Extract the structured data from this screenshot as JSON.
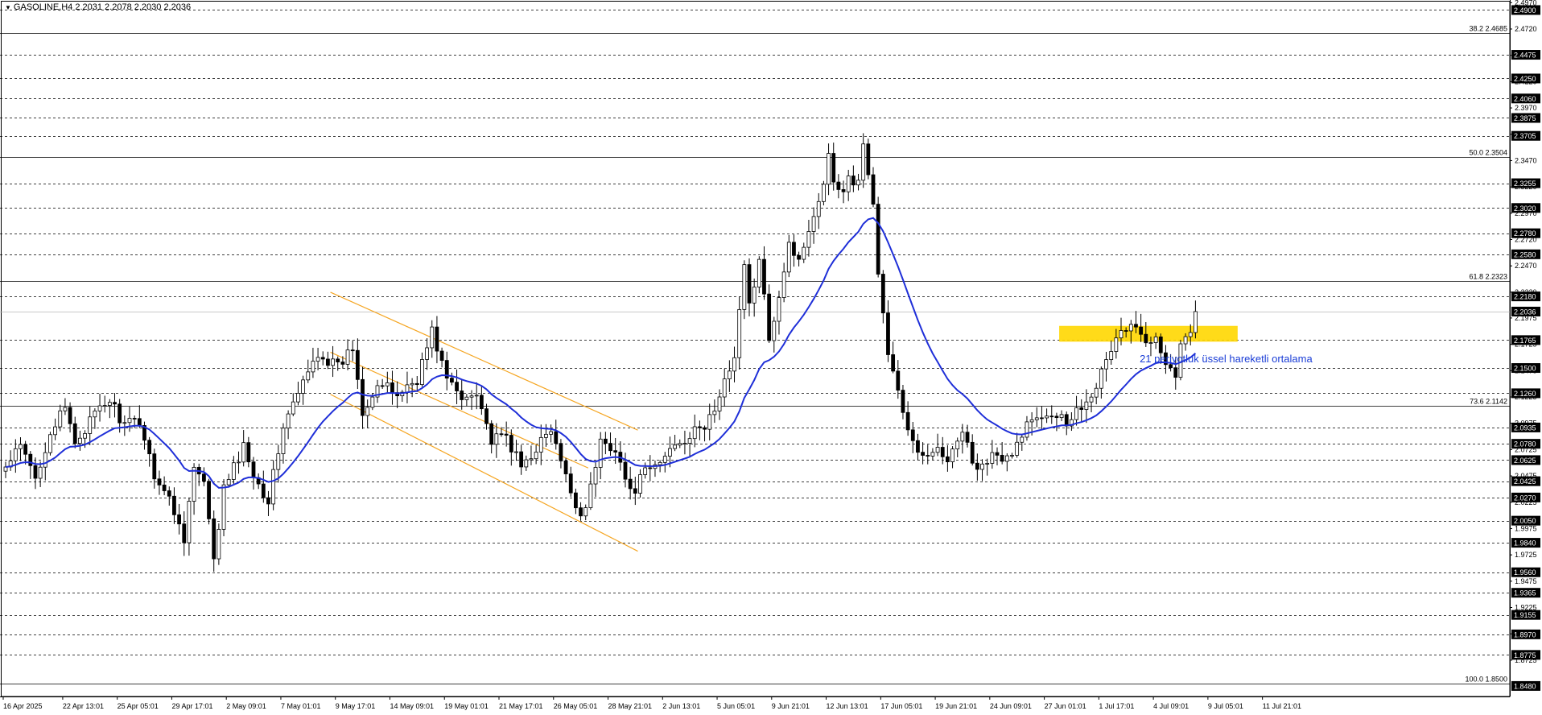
{
  "header": {
    "symbol_info": "GASOLINE,H4  2.2031 2.2078 2.2030 2.2036",
    "menu_icon": "triangle-down-icon"
  },
  "colors": {
    "background": "#ffffff",
    "grid": "#000000",
    "candle": "#000000",
    "ema": "#1f2fd8",
    "channel": "#f5a623",
    "zone": "#ffd700",
    "annotation": "#1a3dd6",
    "price_box_bg": "#000000",
    "price_box_fg": "#ffffff"
  },
  "annotation_text": "21 periyotluk üssel hareketli ortalama",
  "chart_data": {
    "type": "candlestick",
    "ylim": [
      1.838,
      2.498
    ],
    "right_axis_ticks": [
      "2.4970",
      "2.4720",
      "2.4470",
      "2.4220",
      "2.3970",
      "2.3720",
      "2.3470",
      "2.3220",
      "2.2970",
      "2.2720",
      "2.2470",
      "2.2220",
      "2.1975",
      "2.1725",
      "2.1475",
      "2.1225",
      "2.0975",
      "2.0725",
      "2.0475",
      "2.0225",
      "1.9975",
      "1.9725",
      "1.9475",
      "1.9225",
      "1.8975",
      "1.8725"
    ],
    "x_ticks": [
      {
        "label": "16 Apr 2025",
        "bar": 0
      },
      {
        "label": "22 Apr 13:01",
        "bar": 12
      },
      {
        "label": "25 Apr 05:01",
        "bar": 23
      },
      {
        "label": "29 Apr 17:01",
        "bar": 34
      },
      {
        "label": "2 May 09:01",
        "bar": 45
      },
      {
        "label": "7 May 01:01",
        "bar": 56
      },
      {
        "label": "9 May 17:01",
        "bar": 67
      },
      {
        "label": "14 May 09:01",
        "bar": 78
      },
      {
        "label": "19 May 01:01",
        "bar": 89
      },
      {
        "label": "21 May 17:01",
        "bar": 100
      },
      {
        "label": "26 May 05:01",
        "bar": 111
      },
      {
        "label": "28 May 21:01",
        "bar": 122
      },
      {
        "label": "2 Jun 13:01",
        "bar": 133
      },
      {
        "label": "5 Jun 05:01",
        "bar": 144
      },
      {
        "label": "9 Jun 21:01",
        "bar": 155
      },
      {
        "label": "12 Jun 13:01",
        "bar": 166
      },
      {
        "label": "17 Jun 05:01",
        "bar": 177
      },
      {
        "label": "19 Jun 21:01",
        "bar": 188
      },
      {
        "label": "24 Jun 09:01",
        "bar": 199
      },
      {
        "label": "27 Jun 01:01",
        "bar": 210
      },
      {
        "label": "1 Jul 17:01",
        "bar": 221
      },
      {
        "label": "4 Jul 09:01",
        "bar": 232
      },
      {
        "label": "9 Jul 05:01",
        "bar": 243
      },
      {
        "label": "11 Jul 21:01",
        "bar": 254
      }
    ],
    "price_boxes": [
      {
        "label": "2.4900",
        "value": 2.49
      },
      {
        "label": "2.4475",
        "value": 2.4475
      },
      {
        "label": "2.4250",
        "value": 2.425
      },
      {
        "label": "2.4060",
        "value": 2.406
      },
      {
        "label": "2.3875",
        "value": 2.3875
      },
      {
        "label": "2.3705",
        "value": 2.3705
      },
      {
        "label": "2.3255",
        "value": 2.3255
      },
      {
        "label": "2.3020",
        "value": 2.302
      },
      {
        "label": "2.2780",
        "value": 2.278
      },
      {
        "label": "2.2580",
        "value": 2.258
      },
      {
        "label": "2.2180",
        "value": 2.218
      },
      {
        "label": "2.2036",
        "value": 2.2036
      },
      {
        "label": "2.1765",
        "value": 2.1765
      },
      {
        "label": "2.1500",
        "value": 2.15
      },
      {
        "label": "2.1260",
        "value": 2.126
      },
      {
        "label": "2.0935",
        "value": 2.0935
      },
      {
        "label": "2.0780",
        "value": 2.078
      },
      {
        "label": "2.0625",
        "value": 2.0625
      },
      {
        "label": "2.0425",
        "value": 2.0425
      },
      {
        "label": "2.0270",
        "value": 2.027
      },
      {
        "label": "2.0050",
        "value": 2.005
      },
      {
        "label": "1.9840",
        "value": 1.984
      },
      {
        "label": "1.9560",
        "value": 1.956
      },
      {
        "label": "1.9365",
        "value": 1.9365
      },
      {
        "label": "1.9155",
        "value": 1.9155
      },
      {
        "label": "1.8970",
        "value": 1.897
      },
      {
        "label": "1.8775",
        "value": 1.8775
      },
      {
        "label": "1.8480",
        "value": 1.848
      }
    ],
    "dashed_levels": [
      2.49,
      2.4475,
      2.425,
      2.406,
      2.3875,
      2.3705,
      2.3255,
      2.302,
      2.278,
      2.258,
      2.218,
      2.1765,
      2.15,
      2.126,
      2.0935,
      2.078,
      2.0625,
      2.0425,
      2.027,
      2.005,
      1.984,
      1.956,
      1.9365,
      1.9155,
      1.897,
      1.8775
    ],
    "fib_levels": [
      {
        "label": "38.2 2.4685",
        "value": 2.4685
      },
      {
        "label": "50.0 2.3504",
        "value": 2.3504
      },
      {
        "label": "61.8 2.2323",
        "value": 2.2323
      },
      {
        "label": "73.6 2.1142",
        "value": 2.1142
      },
      {
        "label": "100.0 1.8500",
        "value": 1.85
      }
    ],
    "current_price": 2.2036,
    "channel_lines": [
      {
        "x1": 66,
        "y1": 2.222,
        "x2": 128,
        "y2": 2.091
      },
      {
        "x1": 66,
        "y1": 2.125,
        "x2": 128,
        "y2": 1.976
      },
      {
        "x1": 66,
        "y1": 2.165,
        "x2": 118,
        "y2": 2.055
      }
    ],
    "zone": {
      "bar_from": 213,
      "bar_to": 249,
      "y_low": 2.175,
      "y_high": 2.19
    },
    "ema_period": 21,
    "anchors": [
      [
        0,
        2.055
      ],
      [
        3,
        2.075
      ],
      [
        6,
        2.045
      ],
      [
        9,
        2.09
      ],
      [
        12,
        2.11
      ],
      [
        14,
        2.08
      ],
      [
        18,
        2.105
      ],
      [
        21,
        2.12
      ],
      [
        24,
        2.095
      ],
      [
        27,
        2.1
      ],
      [
        30,
        2.05
      ],
      [
        33,
        2.025
      ],
      [
        36,
        1.99
      ],
      [
        38,
        2.055
      ],
      [
        40,
        2.04
      ],
      [
        42,
        1.965
      ],
      [
        44,
        2.035
      ],
      [
        48,
        2.075
      ],
      [
        51,
        2.04
      ],
      [
        53,
        2.025
      ],
      [
        56,
        2.095
      ],
      [
        60,
        2.135
      ],
      [
        63,
        2.165
      ],
      [
        67,
        2.15
      ],
      [
        70,
        2.17
      ],
      [
        72,
        2.11
      ],
      [
        75,
        2.135
      ],
      [
        79,
        2.125
      ],
      [
        83,
        2.14
      ],
      [
        86,
        2.185
      ],
      [
        89,
        2.14
      ],
      [
        92,
        2.12
      ],
      [
        95,
        2.13
      ],
      [
        98,
        2.08
      ],
      [
        101,
        2.085
      ],
      [
        104,
        2.055
      ],
      [
        107,
        2.075
      ],
      [
        110,
        2.09
      ],
      [
        113,
        2.045
      ],
      [
        116,
        2.01
      ],
      [
        118,
        2.035
      ],
      [
        120,
        2.08
      ],
      [
        123,
        2.075
      ],
      [
        126,
        2.03
      ],
      [
        129,
        2.05
      ],
      [
        132,
        2.06
      ],
      [
        135,
        2.08
      ],
      [
        138,
        2.085
      ],
      [
        141,
        2.095
      ],
      [
        144,
        2.12
      ],
      [
        147,
        2.165
      ],
      [
        149,
        2.245
      ],
      [
        150,
        2.21
      ],
      [
        152,
        2.25
      ],
      [
        154,
        2.18
      ],
      [
        156,
        2.22
      ],
      [
        158,
        2.27
      ],
      [
        160,
        2.25
      ],
      [
        162,
        2.285
      ],
      [
        164,
        2.31
      ],
      [
        166,
        2.35
      ],
      [
        168,
        2.315
      ],
      [
        170,
        2.33
      ],
      [
        172,
        2.325
      ],
      [
        173,
        2.365
      ],
      [
        174,
        2.335
      ],
      [
        175,
        2.305
      ],
      [
        176,
        2.24
      ],
      [
        177,
        2.2
      ],
      [
        178,
        2.16
      ],
      [
        180,
        2.13
      ],
      [
        182,
        2.09
      ],
      [
        184,
        2.065
      ],
      [
        187,
        2.075
      ],
      [
        190,
        2.06
      ],
      [
        193,
        2.085
      ],
      [
        196,
        2.055
      ],
      [
        199,
        2.07
      ],
      [
        201,
        2.06
      ],
      [
        203,
        2.065
      ],
      [
        205,
        2.09
      ],
      [
        208,
        2.105
      ],
      [
        211,
        2.11
      ],
      [
        214,
        2.1
      ],
      [
        217,
        2.115
      ],
      [
        220,
        2.135
      ],
      [
        222,
        2.155
      ],
      [
        224,
        2.18
      ],
      [
        227,
        2.19
      ],
      [
        230,
        2.175
      ],
      [
        232,
        2.185
      ],
      [
        234,
        2.155
      ],
      [
        236,
        2.145
      ],
      [
        237,
        2.17
      ],
      [
        239,
        2.185
      ],
      [
        240,
        2.2036
      ]
    ]
  }
}
